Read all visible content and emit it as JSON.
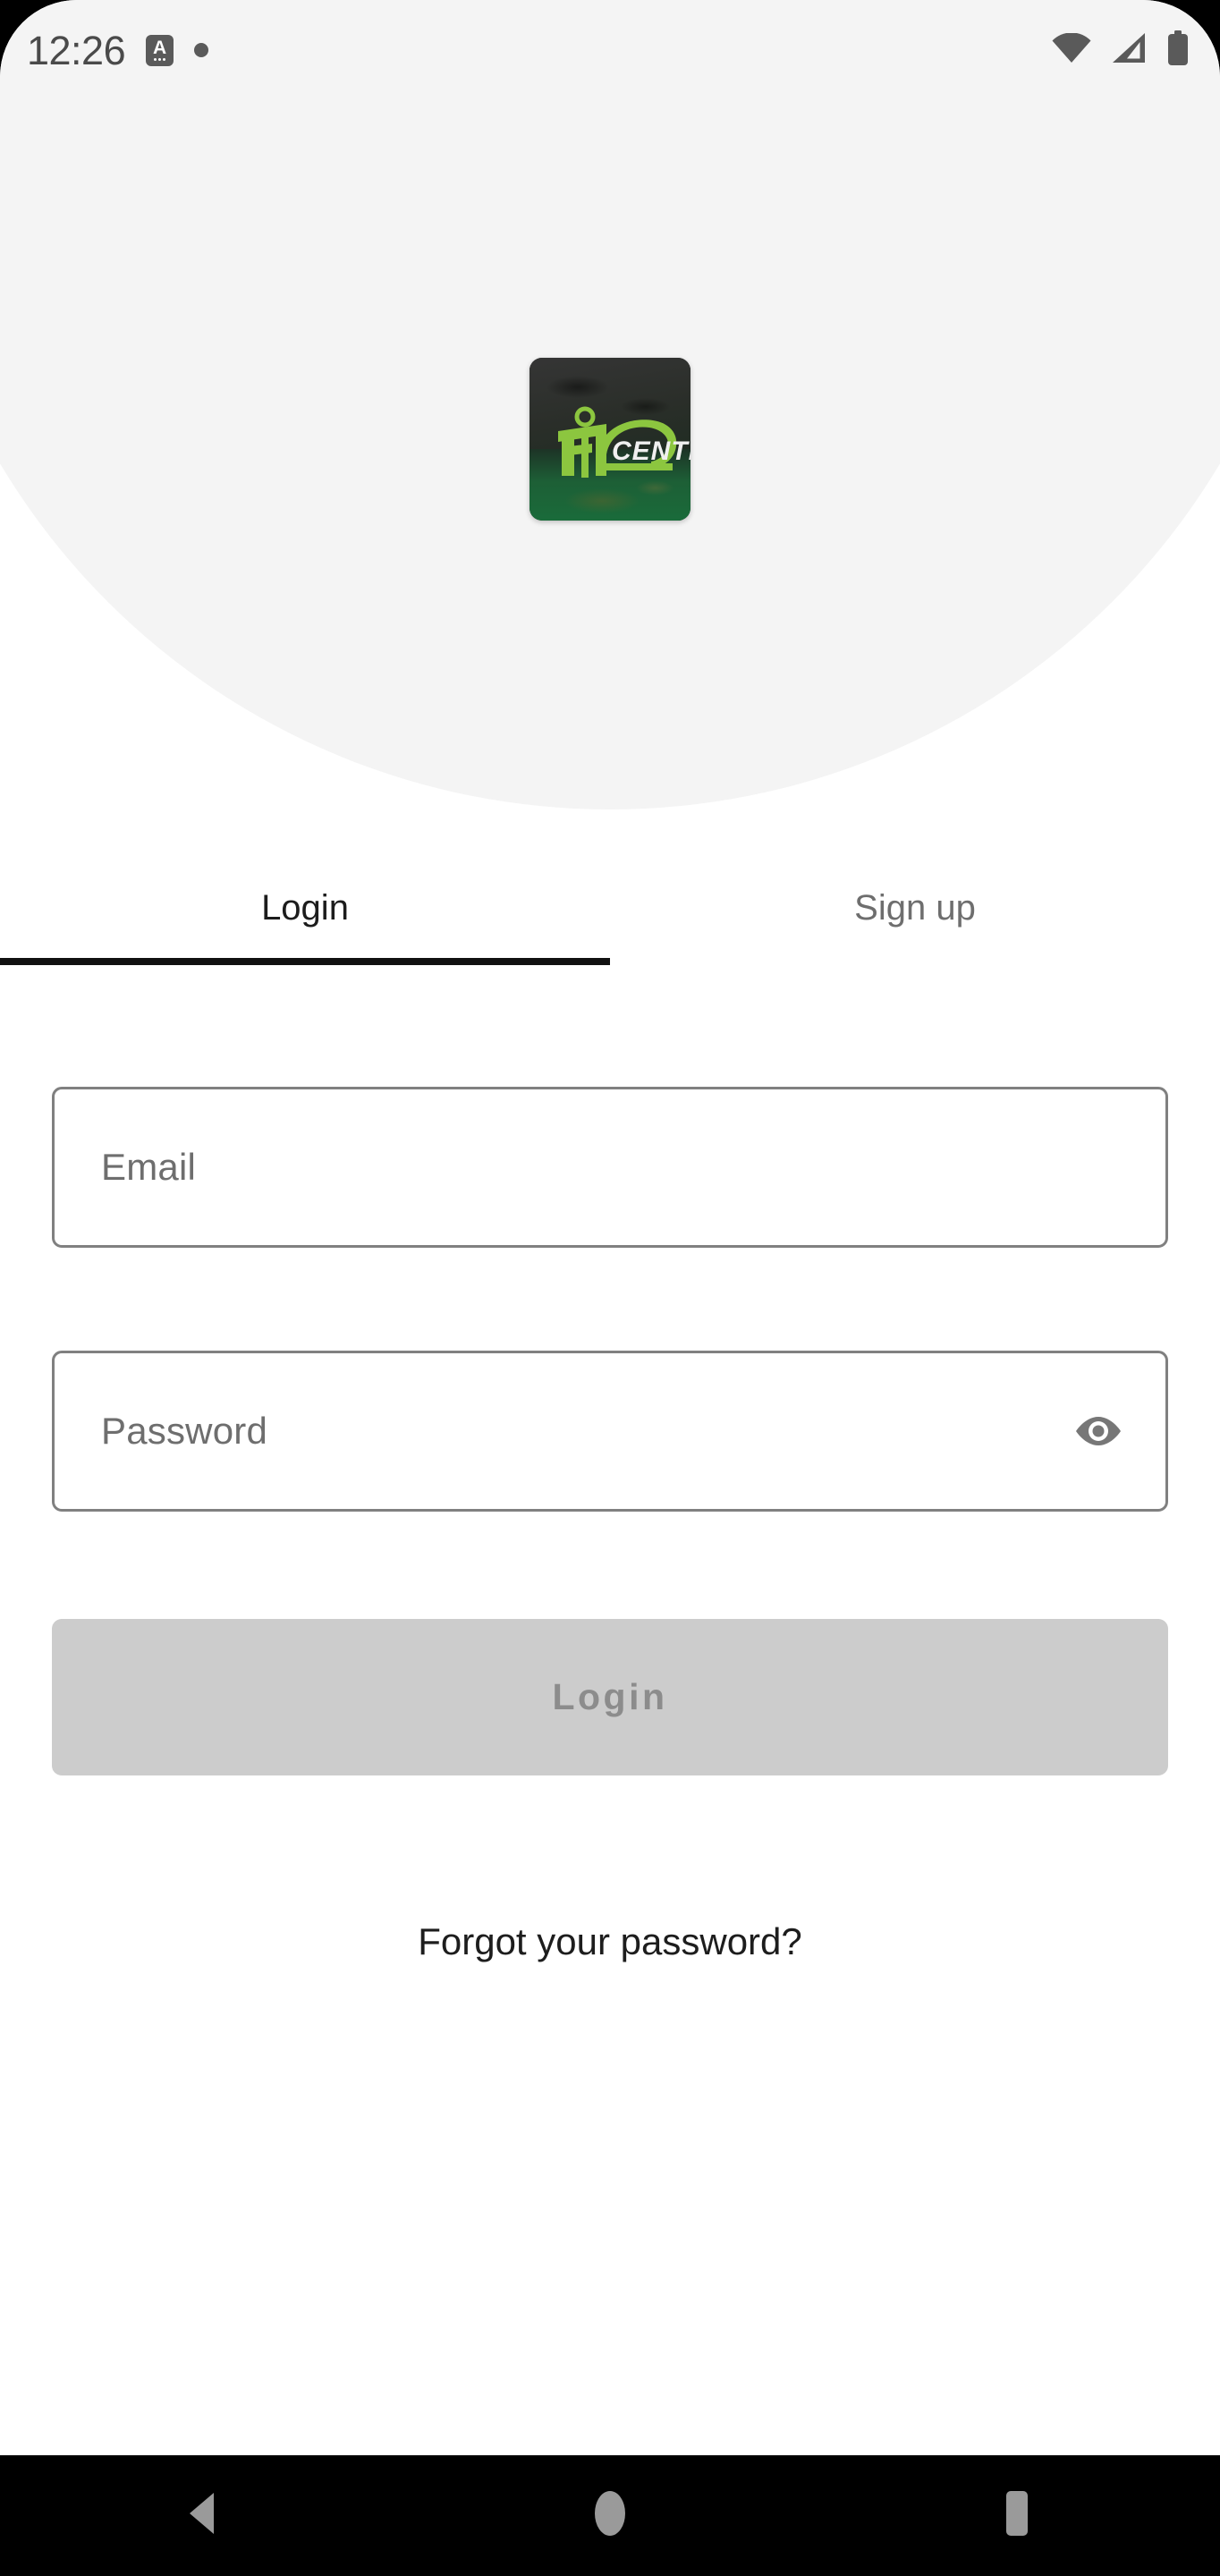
{
  "status_bar": {
    "time": "12:26",
    "app_badge_glyph": "A",
    "icons": {
      "wifi": "wifi-icon",
      "signal": "cellular-signal-icon",
      "battery": "battery-full-icon",
      "notification_dot": "notification-dot-icon",
      "app_badge": "font-size-a-icon"
    }
  },
  "brand": {
    "logo_name": "fit-center-logo",
    "logo_text_primary": "FiT",
    "logo_text_secondary": "CENTER",
    "colors": {
      "accent_green": "#8CC63F",
      "logo_dark": "#2a2e29",
      "logo_green_bottom": "#1a6b3a",
      "logo_text_white": "#f0f0f0"
    }
  },
  "tabs": [
    {
      "label": "Login",
      "active": true
    },
    {
      "label": "Sign up",
      "active": false
    }
  ],
  "form": {
    "email": {
      "placeholder": "Email",
      "value": ""
    },
    "password": {
      "placeholder": "Password",
      "value": "",
      "toggle_icon": "eye-icon",
      "visible": false
    },
    "submit": {
      "label": "Login",
      "enabled": false
    },
    "forgot_password_label": "Forgot your password?"
  },
  "nav_bar": {
    "back": "back-triangle-icon",
    "home": "home-circle-icon",
    "recents": "recents-square-icon"
  },
  "colors": {
    "header_background": "#f4f4f4",
    "page_background": "#ffffff",
    "field_border": "#808080",
    "placeholder_text": "#6e6e6e",
    "tab_active_text": "#1c1c1c",
    "tab_inactive_text": "#6e6e6e",
    "tab_indicator": "#111111",
    "button_disabled_bg": "#cccccc",
    "button_disabled_text": "#8c8c8c",
    "nav_bar_bg": "#000000",
    "nav_icon": "#9a9a9a"
  }
}
